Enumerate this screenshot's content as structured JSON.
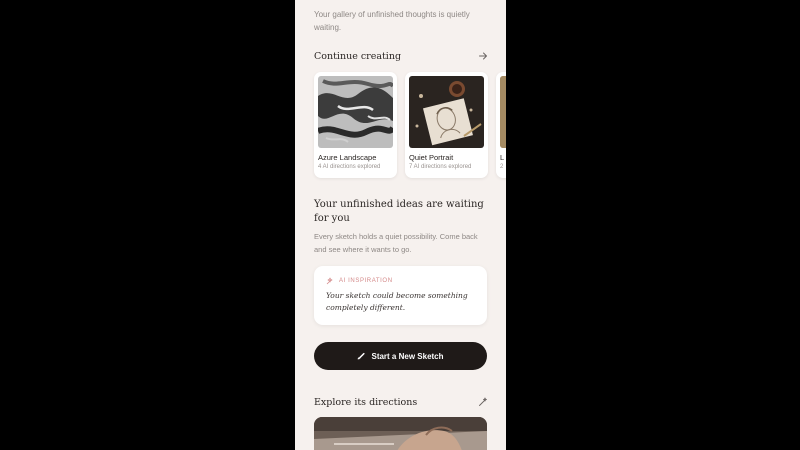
{
  "intro_text": "Your gallery of unfinished thoughts is quietly waiting.",
  "continue_section": {
    "title": "Continue creating",
    "arrow_icon": "arrow-right-icon"
  },
  "cards": [
    {
      "title": "Azure Landscape",
      "subtitle": "4 AI directions explored"
    },
    {
      "title": "Quiet Portrait",
      "subtitle": "7 AI directions explored"
    },
    {
      "title": "L",
      "subtitle": "2"
    }
  ],
  "headline": "Your unfinished ideas are waiting for you",
  "body_text": "Every sketch holds a quiet possibility. Come back and see where it wants to go.",
  "inspiration": {
    "label": "AI INSPIRATION",
    "icon": "sparkle-icon",
    "quote": "Your sketch could become something completely different."
  },
  "cta": {
    "label": "Start a New Sketch",
    "icon": "brush-icon"
  },
  "directions_section": {
    "title": "Explore its directions",
    "icon": "magic-wand-icon"
  },
  "colors": {
    "background": "#f6f1ee",
    "accent": "#d48a8a",
    "button": "#1f1a18"
  }
}
